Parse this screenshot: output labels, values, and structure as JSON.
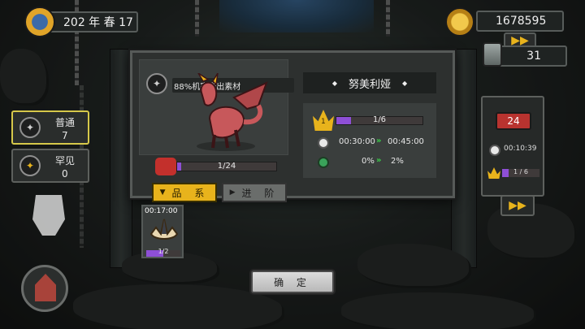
{
  "hud": {
    "date": "202 年 春 17",
    "gold": "1678595",
    "gems": "31"
  },
  "left_panel": {
    "common_label": "普通",
    "common_count": "7",
    "rare_label": "罕见",
    "rare_count": "0"
  },
  "right_panel": {
    "level_badge": "24",
    "timer": "00:10:39",
    "rank_progress": "1 / 6"
  },
  "dialog": {
    "material_chance": "88%机率产出素材",
    "creature_progress": "1/24",
    "creature_progress_value": 0.0417,
    "name": "努美利娅",
    "rank_level": "1",
    "rank_progress": "1/6",
    "rank_progress_value": 0.1667,
    "time_current": "00:30:00",
    "time_next": "00:45:00",
    "rate_current": "0%",
    "rate_next": "2%",
    "tab_quality": "品 系",
    "tab_advance": "进 阶"
  },
  "slot": {
    "timer": "00:17:00",
    "progress": "1/2",
    "progress_value": 0.5
  },
  "confirm_label": "确 定",
  "colors": {
    "gold_accent": "#e8b31c",
    "purple_bar": "#8e4fd6",
    "green_arrow": "#3bd04a",
    "red_badge": "#c3302c"
  }
}
